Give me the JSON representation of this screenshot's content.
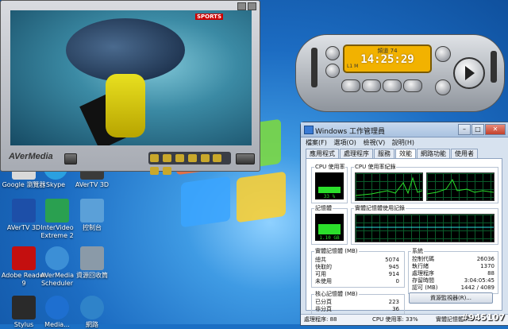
{
  "player": {
    "brand": "AVerMedia",
    "overlay_logo": "SPORTS"
  },
  "remote": {
    "channel": "頻道 74",
    "time": "14:25:29",
    "lcd_small": "L1 M"
  },
  "desktop_icons": [
    {
      "label": "Google 瀏覽器",
      "color": "#d9d9d9"
    },
    {
      "label": "Skype",
      "color": "#2aa0e0"
    },
    {
      "label": "AVerTV 3D",
      "color": "#3a3a3a"
    },
    {
      "label": "AVerTV 3D",
      "color": "#1d4fa8"
    },
    {
      "label": "InterVideo Extreme 2",
      "color": "#2aa050"
    },
    {
      "label": "控制台",
      "color": "#5ba0d8"
    },
    {
      "label": "Adobe Reader 9",
      "color": "#c40f0f"
    },
    {
      "label": "AVerMedia Scheduler",
      "color": "#3c8fd6"
    },
    {
      "label": "資源回收筒",
      "color": "#8a9aa8"
    },
    {
      "label": "Stylus",
      "color": "#2a2a2a"
    },
    {
      "label": "Media...",
      "color": "#1e6fd0"
    },
    {
      "label": "網路",
      "color": "#2f83c9"
    }
  ],
  "taskmanager": {
    "title": "Windows 工作管理員",
    "menu": [
      "檔案(F)",
      "選項(O)",
      "檢視(V)",
      "說明(H)"
    ],
    "tabs": [
      "應用程式",
      "處理程序",
      "服務",
      "效能",
      "網路功能",
      "使用者"
    ],
    "active_tab": 3,
    "cpu_usage_label": "CPU 使用率",
    "cpu_usage_value": "33 %",
    "cpu_history_label": "CPU 使用率紀錄",
    "memory_label": "記憶體",
    "memory_value": "1.10 GB",
    "memory_history_label": "實體記憶體使用記錄",
    "physical_memory_label": "實體記憶體 (MB)",
    "physical_memory": [
      {
        "k": "總共",
        "v": "5074"
      },
      {
        "k": "快取的",
        "v": "945"
      },
      {
        "k": "可用",
        "v": "914"
      },
      {
        "k": "未使用",
        "v": "0"
      }
    ],
    "system_label": "系統",
    "system": [
      {
        "k": "控制代碼",
        "v": "26036"
      },
      {
        "k": "執行緒",
        "v": "1370"
      },
      {
        "k": "處理程序",
        "v": "88"
      },
      {
        "k": "存留時間",
        "v": "3:04:05:45"
      },
      {
        "k": "認可 (MB)",
        "v": "1442 / 4089"
      }
    ],
    "kernel_memory_label": "核心記憶體 (MB)",
    "kernel_memory": [
      {
        "k": "已分頁",
        "v": "223"
      },
      {
        "k": "非分頁",
        "v": "36"
      }
    ],
    "resource_monitor_button": "資源監視器(R)...",
    "status": {
      "processes": "處理程序: 88",
      "cpu": "CPU 使用率: 33%",
      "memory": "實體記憶體: 55%"
    },
    "cpu_percent": 33,
    "memory_percent": 55
  },
  "watermark": "#945107"
}
